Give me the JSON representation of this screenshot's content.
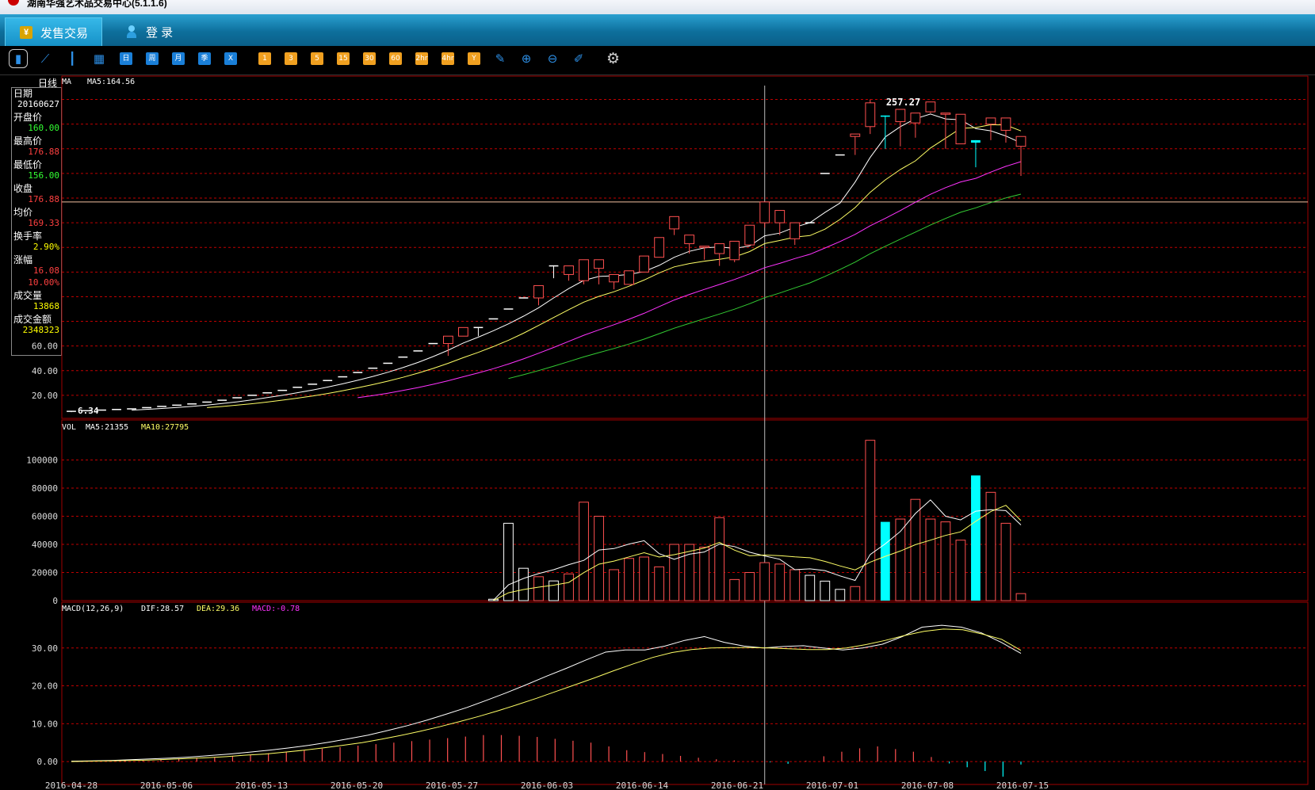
{
  "window": {
    "title": "湖南华强艺术品交易中心(5.1.1.6)"
  },
  "tabs": [
    {
      "label": "发售交易",
      "icon": "yen-coin-icon",
      "active": true
    },
    {
      "label": "登  录",
      "icon": "user-icon",
      "active": false
    }
  ],
  "toolbar": {
    "chart_icons": [
      "bar-chart-icon",
      "line-chart-icon",
      "candlestick-icon",
      "calendar-icon"
    ],
    "periods": [
      "日",
      "周",
      "月",
      "季",
      "X"
    ],
    "minutes": [
      "1",
      "3",
      "5",
      "15",
      "30",
      "60",
      "2hr",
      "4hr",
      "Y"
    ],
    "tools": [
      "edit-icon",
      "zoom-in-icon",
      "zoom-out-icon",
      "draw-icon",
      "gear-icon"
    ]
  },
  "info_panel": {
    "header": "日线",
    "rows": [
      {
        "label": "日期",
        "value": "20160627",
        "color": "#ffffff"
      },
      {
        "label": "开盘价",
        "value": "160.00",
        "color": "#33ff33"
      },
      {
        "label": "最高价",
        "value": "176.88",
        "color": "#ff4040"
      },
      {
        "label": "最低价",
        "value": "156.00",
        "color": "#33ff33"
      },
      {
        "label": "收盘",
        "value": "176.88",
        "color": "#ff4040"
      },
      {
        "label": "均价",
        "value": "169.33",
        "color": "#ff4040"
      },
      {
        "label": "换手率",
        "value": "2.90%",
        "color": "#ffff00"
      },
      {
        "label": "涨幅",
        "value": "16.08",
        "color": "#ff4040"
      },
      {
        "label": "",
        "value": "10.00%",
        "color": "#ff4040"
      },
      {
        "label": "成交量",
        "value": "13868",
        "color": "#ffff00"
      },
      {
        "label": "成交金额",
        "value": "2348323",
        "color": "#ffff00"
      }
    ]
  },
  "legends": {
    "ma": {
      "name": "MA",
      "ma5": "MA5:164.56"
    },
    "vol": {
      "name": "VOL",
      "ma5": "MA5:21355",
      "ma10": "MA10:27795"
    },
    "macd": {
      "name": "MACD(12,26,9)",
      "dif": "DIF:28.57",
      "dea": "DEA:29.36",
      "macd": "MACD:-0.78"
    }
  },
  "price_labels": {
    "high": "257.27",
    "low": "6.34"
  },
  "colors": {
    "up": "#ff5050",
    "down": "#00ffff",
    "grid": "#c00000",
    "ma5": "#ffffff",
    "ma10": "#ffff66",
    "ma20": "#ff33ff",
    "ma30": "#33cc33"
  },
  "chart_data": [
    {
      "type": "candlestick",
      "name": "price",
      "y_ticks": [
        "20.00",
        "40.00",
        "60.00"
      ],
      "ylim": [
        0,
        270
      ],
      "candles": [
        [
          7,
          7,
          6.34,
          7
        ],
        [
          7.5,
          7.5,
          7.5,
          7.5
        ],
        [
          8,
          8,
          8,
          8
        ],
        [
          8.5,
          8.5,
          8.5,
          8.5
        ],
        [
          9,
          9,
          9,
          9
        ],
        [
          10,
          10,
          10,
          10
        ],
        [
          11,
          11,
          11,
          11
        ],
        [
          12,
          12,
          12,
          12
        ],
        [
          13,
          13,
          13,
          13
        ],
        [
          14.5,
          14.5,
          14.5,
          14.5
        ],
        [
          16,
          16,
          16,
          16
        ],
        [
          18,
          18,
          18,
          18
        ],
        [
          20,
          20,
          20,
          20
        ],
        [
          22,
          22,
          22,
          22
        ],
        [
          24,
          24,
          24,
          24
        ],
        [
          26.5,
          26.5,
          26.5,
          26.5
        ],
        [
          29,
          29,
          29,
          29
        ],
        [
          32,
          32,
          32,
          32
        ],
        [
          35,
          35,
          35,
          35
        ],
        [
          38.5,
          38.5,
          38.5,
          38.5
        ],
        [
          42,
          42,
          42,
          42
        ],
        [
          46,
          46,
          46,
          46
        ],
        [
          51,
          51,
          51,
          51
        ],
        [
          56,
          56,
          56,
          56
        ],
        [
          62,
          62,
          62,
          62
        ],
        [
          62,
          68,
          52,
          68
        ],
        [
          68,
          75,
          68,
          75
        ],
        [
          75,
          75,
          68,
          75
        ],
        [
          82,
          82,
          82,
          82
        ],
        [
          90,
          90,
          90,
          90
        ],
        [
          99,
          99,
          99,
          99
        ],
        [
          99,
          109,
          93,
          109
        ],
        [
          125,
          125,
          115,
          115
        ],
        [
          118,
          125,
          113,
          120
        ],
        [
          113,
          130,
          110,
          123
        ],
        [
          123,
          130,
          110,
          115
        ],
        [
          112,
          118,
          106,
          112
        ],
        [
          110,
          121,
          110,
          120
        ],
        [
          120,
          133,
          120,
          132
        ],
        [
          132,
          148,
          132,
          148
        ],
        [
          155,
          165,
          150,
          148
        ],
        [
          143,
          150,
          135,
          136
        ],
        [
          140,
          141,
          130,
          134
        ],
        [
          135,
          143,
          125,
          136
        ],
        [
          130,
          145,
          128,
          142
        ],
        [
          142,
          158,
          142,
          158
        ],
        [
          160,
          176.88,
          156,
          176.88
        ],
        [
          160,
          170,
          150,
          145
        ],
        [
          147,
          160,
          142,
          160
        ],
        [
          160,
          160,
          160,
          160
        ],
        [
          200,
          200,
          200,
          200
        ],
        [
          215,
          215,
          215,
          215
        ],
        [
          230,
          232,
          215,
          230
        ],
        [
          238,
          257.27,
          232,
          260
        ],
        [
          247,
          246,
          220,
          243
        ],
        [
          242,
          252,
          222,
          242
        ],
        [
          241,
          249,
          229,
          247
        ],
        [
          250,
          258,
          249,
          249
        ],
        [
          248,
          249,
          220,
          240
        ],
        [
          224,
          248,
          224,
          240
        ],
        [
          227,
          225,
          205,
          206
        ],
        [
          240,
          245,
          227,
          238
        ],
        [
          235,
          245,
          225,
          228
        ],
        [
          222,
          230,
          198,
          212
        ]
      ],
      "x_labels": [
        "2016-04-28",
        "2016-05-06",
        "2016-05-13",
        "2016-05-20",
        "2016-05-27",
        "2016-06-03",
        "2016-06-14",
        "2016-06-21",
        "2016-07-01",
        "2016-07-08",
        "2016-07-15"
      ]
    },
    {
      "type": "bar",
      "name": "volume",
      "y_ticks": [
        "0",
        "20000",
        "40000",
        "60000",
        "80000",
        "100000"
      ],
      "ylim": [
        0,
        120000
      ],
      "values": [
        0,
        0,
        0,
        0,
        0,
        0,
        0,
        0,
        0,
        0,
        0,
        0,
        0,
        0,
        0,
        0,
        0,
        0,
        0,
        0,
        0,
        0,
        0,
        0,
        1000,
        55000,
        23000,
        17000,
        14000,
        19000,
        70000,
        60000,
        22000,
        30000,
        31000,
        24000,
        40000,
        40000,
        38000,
        59000,
        15000,
        20000,
        27000,
        26000,
        22000,
        18000,
        13868,
        8000,
        10000,
        114000,
        56000,
        58000,
        72000,
        58000,
        56000,
        43000,
        89000,
        77000,
        55000,
        5000
      ]
    },
    {
      "type": "bar+line",
      "name": "macd",
      "y_ticks": [
        "0.00",
        "10.00",
        "20.00",
        "30.00"
      ],
      "ylim": [
        -5,
        40
      ],
      "dif": [
        0.1,
        0.2,
        0.3,
        0.5,
        0.7,
        0.9,
        1.2,
        1.6,
        2,
        2.5,
        3,
        3.6,
        4.3,
        5.1,
        6,
        7,
        8.2,
        9.5,
        11,
        12.6,
        14.3,
        16.2,
        18.2,
        20.3,
        22.5,
        24.6,
        26.8,
        28.9,
        29.5,
        29.5,
        30.5,
        32,
        33,
        31.5,
        30.5,
        30,
        30.4,
        30.6,
        30,
        29.5,
        30,
        31,
        33,
        35.5,
        36,
        35.5,
        34,
        31.5,
        28.57
      ],
      "dea": [
        0,
        0.1,
        0.2,
        0.3,
        0.4,
        0.6,
        0.8,
        1,
        1.3,
        1.7,
        2,
        2.5,
        3,
        3.6,
        4.3,
        5,
        5.9,
        6.9,
        8,
        9.2,
        10.5,
        11.9,
        13.4,
        15,
        16.7,
        18.5,
        20.3,
        22.1,
        24,
        25.8,
        27.5,
        28.8,
        29.6,
        30,
        30.1,
        30.1,
        30,
        29.8,
        29.6,
        29.6,
        30,
        30.9,
        32,
        33.3,
        34.4,
        35,
        34.8,
        33.7,
        32.3,
        29.36
      ],
      "macd": [
        0,
        0,
        0,
        0.2,
        0.4,
        0.6,
        0.8,
        1,
        1.2,
        1.5,
        1.8,
        2.2,
        2.6,
        3,
        3.4,
        3.8,
        4.2,
        4.6,
        5,
        5.4,
        5.8,
        6.2,
        6.6,
        7,
        7,
        6.8,
        6.5,
        6,
        5.5,
        5,
        4,
        3,
        2.5,
        2,
        1.5,
        1,
        0.6,
        0.3,
        0.1,
        -0.2,
        -0.6,
        0.2,
        1.4,
        2.6,
        3.5,
        4,
        3.3,
        2.6,
        1.2,
        -0.5,
        -1.5,
        -2.5,
        -4,
        -0.78
      ]
    }
  ]
}
